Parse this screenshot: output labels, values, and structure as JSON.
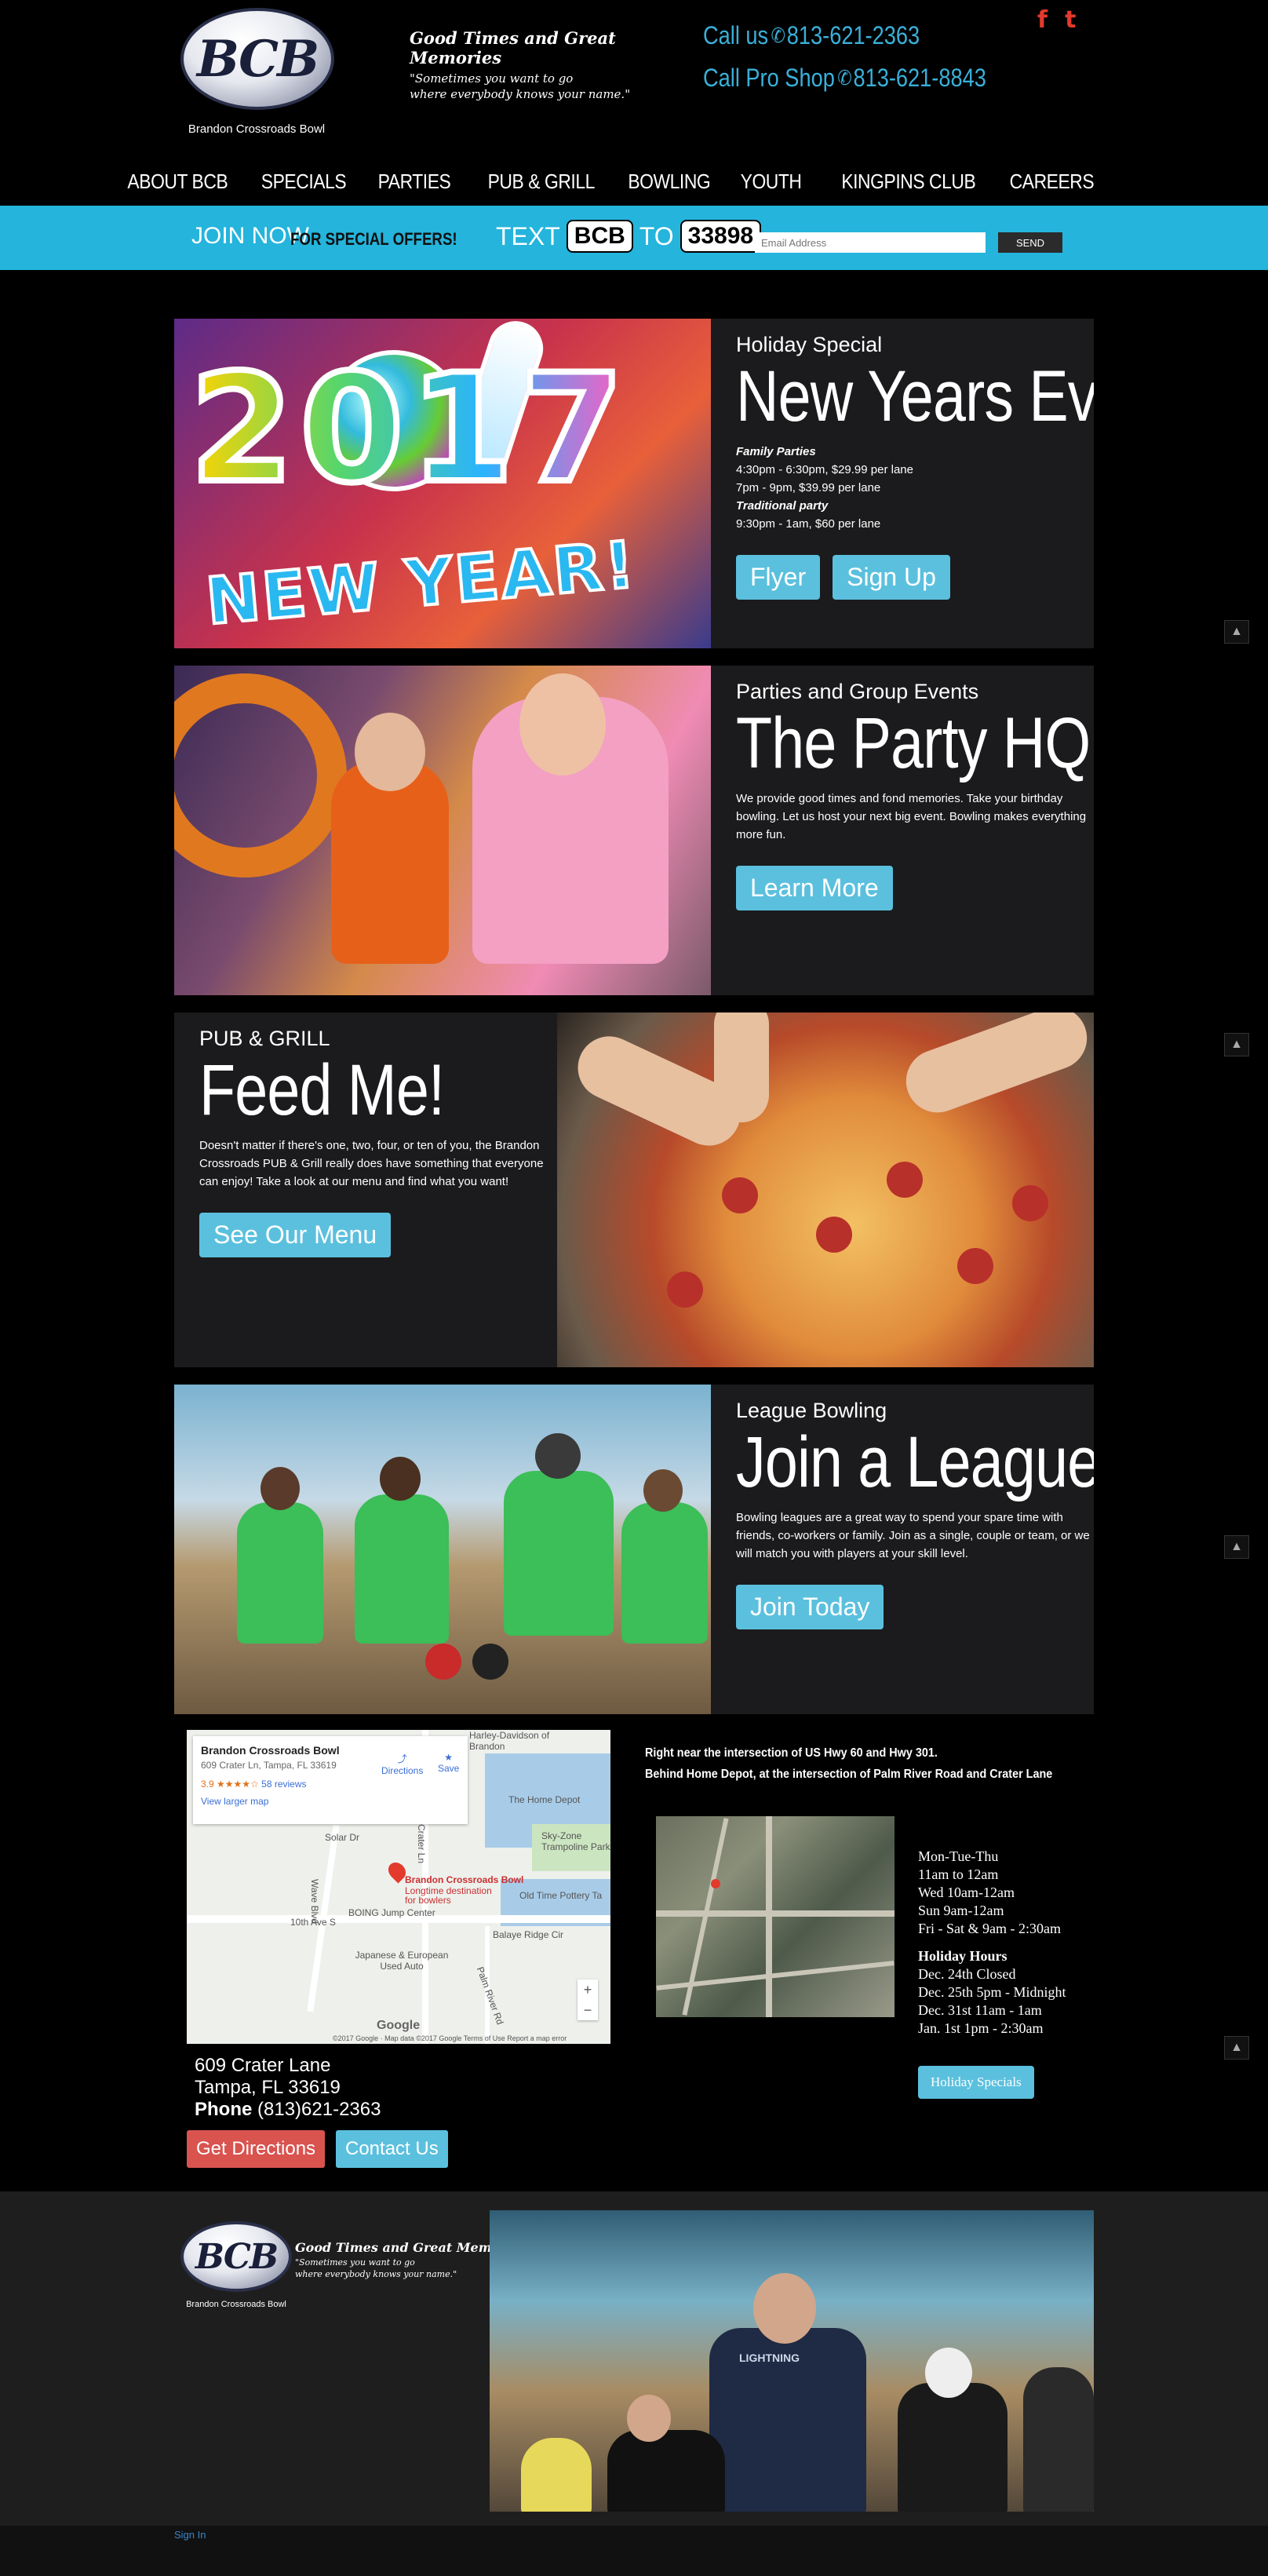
{
  "header": {
    "logo_text": "BCB",
    "logo_caption": "Brandon Crossroads Bowl",
    "tagline": "Good Times and Great Memories",
    "tagline_sub1": "\"Sometimes you want to go",
    "tagline_sub2": "where everybody knows your name.\"",
    "call_label": "Call us",
    "call_number": "813-621-2363",
    "pro_shop_label": "Call Pro Shop",
    "pro_shop_number": "813-621-8843",
    "social": [
      {
        "icon": "facebook-icon",
        "glyph": "f"
      },
      {
        "icon": "twitter-icon",
        "glyph": "t"
      }
    ],
    "accent_color": "#3ab0d9",
    "social_color": "#e23a2d"
  },
  "nav": [
    "ABOUT BCB",
    "SPECIALS",
    "PARTIES",
    "PUB & GRILL",
    "BOWLING",
    "YOUTH",
    "KINGPINS CLUB",
    "CAREERS"
  ],
  "join_bar": {
    "join_now": "JOIN NOW",
    "special_offers": "FOR SPECIAL OFFERS!",
    "text_label": "TEXT",
    "keyword": "BCB",
    "to_label": "TO",
    "shortcode": "33898",
    "email_placeholder": "Email Address",
    "send_label": "SEND",
    "bar_color": "#24b4dc"
  },
  "panels": {
    "new_years": {
      "kicker": "Holiday Special",
      "headline": "New Years Eve",
      "image_year": "2017",
      "image_caption": "NEW YEAR!",
      "family_label": "Family Parties",
      "line1": "4:30pm - 6:30pm, $29.99 per lane",
      "line2": "7pm - 9pm, $39.99 per lane",
      "traditional_label": "Traditional party",
      "line3": "9:30pm - 1am, $60 per lane",
      "btn_flyer": "Flyer",
      "btn_signup": "Sign Up"
    },
    "party": {
      "kicker": "Parties and Group Events",
      "headline": "The Party HQ",
      "body": "We provide good times and fond memories. Take your birthday bowling. Let us host your next big event. Bowling makes everything more fun.",
      "btn": "Learn More"
    },
    "pub": {
      "kicker": "PUB & GRILL",
      "headline": "Feed Me!",
      "body": "Doesn't matter if there's one, two, four, or ten of you, the Brandon Crossroads PUB & Grill really does have something that everyone can enjoy! Take a look at our menu and find what you want!",
      "btn": "See Our Menu"
    },
    "league": {
      "kicker": "League Bowling",
      "headline": "Join a League",
      "body": "Bowling leagues are a great way to spend your spare time with friends, co-workers or family. Join as a single, couple or team, or we will match you with players at your skill level.",
      "btn": "Join Today"
    },
    "button_color": "#5bc0de",
    "panel_bg": "#1b1b1d"
  },
  "map": {
    "place_name": "Brandon Crossroads Bowl",
    "place_address": "609 Crater Ln, Tampa, FL 33619",
    "rating": "3.9 ★★★★☆",
    "reviews": "58 reviews",
    "larger_map": "View larger map",
    "directions": "Directions",
    "save": "Save",
    "pin_title": "Brandon Crossroads Bowl",
    "pin_sub1": "Longtime destination",
    "pin_sub2": "for bowlers",
    "labels": [
      "Harley-Davidson of Brandon",
      "The Home Depot",
      "Sky-Zone Trampoline Park",
      "Old Time Pottery Ta",
      "BOING Jump Center",
      "10th Ave S",
      "Japanese & European Used Auto",
      "Balaye Ridge Cir",
      "Crater Ln",
      "Wave Blvd",
      "Solar Dr",
      "Palm River Rd"
    ],
    "google": "Google",
    "terms": "©2017 Google · Map data ©2017 Google    Terms of Use    Report a map error"
  },
  "location": {
    "street": "609 Crater Lane",
    "city": "Tampa, FL 33619",
    "phone_label": "Phone",
    "phone": "(813)621-2363",
    "btn_directions": "Get Directions",
    "btn_contact": "Contact Us",
    "intersection1": "Right near the intersection of US Hwy 60 and Hwy 301.",
    "intersection2": "Behind Home Depot, at the intersection of Palm River Road and Crater Lane"
  },
  "hours": {
    "regular": [
      "Mon-Tue-Thu",
      "11am to 12am",
      "Wed 10am-12am",
      "Sun 9am-12am",
      "Fri - Sat & 9am - 2:30am"
    ],
    "holiday_title": "Holiday Hours",
    "holiday": [
      "Dec. 24th Closed",
      "Dec. 25th 5pm - Midnight",
      "Dec. 31st 11am - 1am",
      "Jan. 1st 1pm - 2:30am"
    ],
    "holiday_btn": "Holiday Specials"
  },
  "footer": {
    "logo_text": "BCB",
    "logo_caption": "Brandon Crossroads Bowl",
    "tagline": "Good Times and Great Memories",
    "tagline_sub1": "\"Sometimes you want to go",
    "tagline_sub2": "where everybody knows your name.\"",
    "sign_in": "Sign In",
    "shirt_text": "LIGHTNING"
  }
}
